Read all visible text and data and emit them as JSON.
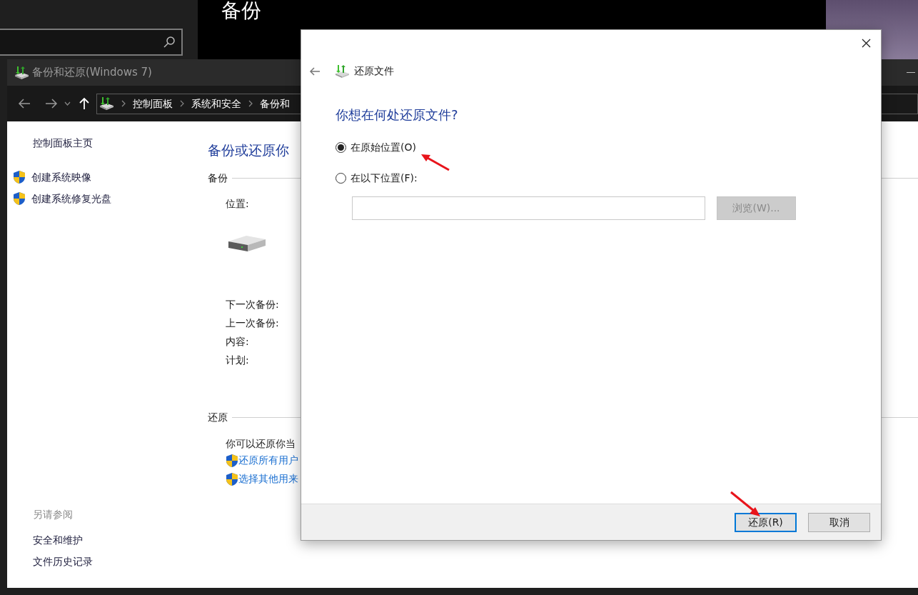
{
  "desktop_heading": "备份",
  "control_panel": {
    "title": "备份和还原(Windows 7)",
    "breadcrumb": [
      "控制面板",
      "系统和安全",
      "备份和"
    ],
    "sidebar": {
      "home": "控制面板主页",
      "tasks": [
        {
          "label": "创建系统映像"
        },
        {
          "label": "创建系统修复光盘"
        }
      ],
      "see_also_heading": "另请参阅",
      "see_also": [
        "安全和维护",
        "文件历史记录"
      ]
    },
    "main": {
      "title": "备份或还原你",
      "backup_section": "备份",
      "location_label": "位置:",
      "backup_fields": [
        "下一次备份:",
        "上一次备份:",
        "内容:",
        "计划:"
      ],
      "restore_section": "还原",
      "restore_text": "你可以还原你当",
      "restore_links": [
        "还原所有用户",
        "选择其他用来"
      ]
    }
  },
  "dialog": {
    "title": "还原文件",
    "question": "你想在何处还原文件?",
    "options": [
      {
        "label": "在原始位置(O)",
        "selected": true
      },
      {
        "label": "在以下位置(F):",
        "selected": false
      }
    ],
    "browse_button": {
      "label": "浏览(W)...",
      "disabled": true
    },
    "buttons": [
      {
        "label": "还原(R)",
        "default": true
      },
      {
        "label": "取消",
        "default": false
      }
    ]
  }
}
